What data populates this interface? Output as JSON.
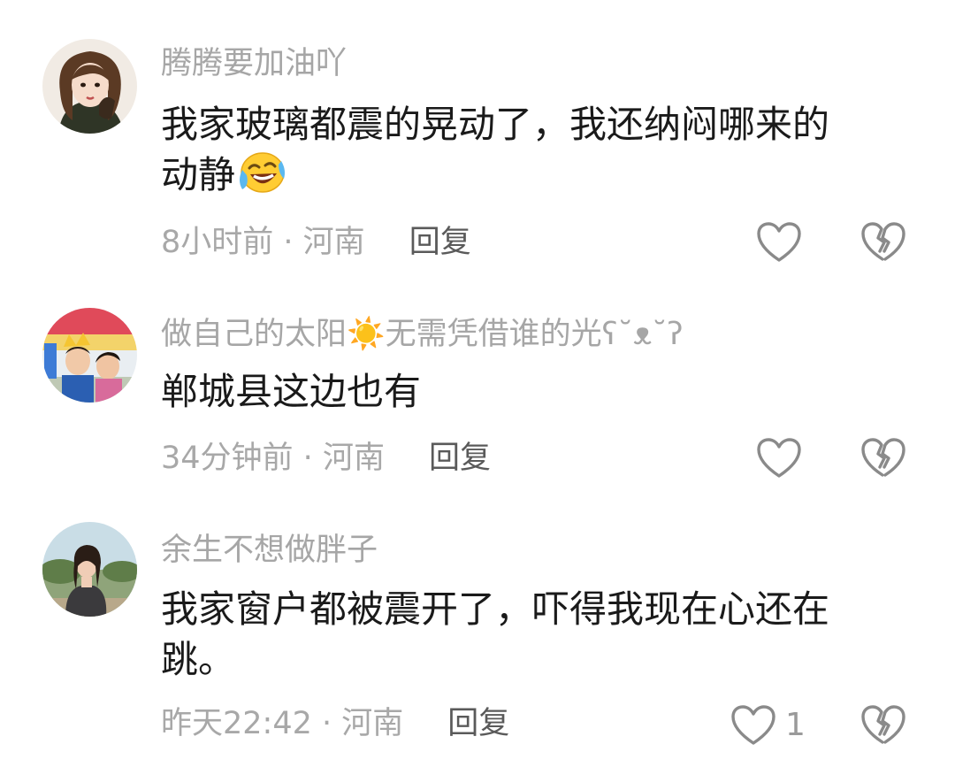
{
  "comments": [
    {
      "username": "腾腾要加油吖",
      "text_line1": "我家玻璃都震的晃动了，我还纳闷哪来的",
      "text_line2": "动静",
      "emoji": "laugh-crying-emoji",
      "time": "8小时前",
      "separator": " · ",
      "location": "河南",
      "reply": "回复",
      "like_count": "",
      "like_icon": "heart-outline-icon",
      "dislike_icon": "broken-heart-icon"
    },
    {
      "username": "做自己的太阳☀️无需凭借谁的光ʕ˘ᴥ˘ʔ",
      "text_line1": "郸城县这边也有",
      "time": "34分钟前",
      "separator": " · ",
      "location": "河南",
      "reply": "回复",
      "like_count": "",
      "like_icon": "heart-outline-icon",
      "dislike_icon": "broken-heart-icon"
    },
    {
      "username": "余生不想做胖子",
      "text_line1": "我家窗户都被震开了，吓得我现在心还在",
      "text_line2": "跳。",
      "time": "昨天22:42",
      "separator": " · ",
      "location": "河南",
      "reply": "回复",
      "like_count": "1",
      "like_icon": "heart-outline-icon",
      "dislike_icon": "broken-heart-icon"
    }
  ],
  "colors": {
    "username": "#a6a6a6",
    "text": "#1a1a1a",
    "meta": "#a8a8a8",
    "reply": "#5a5a5a",
    "icon": "#8a8a8a"
  }
}
